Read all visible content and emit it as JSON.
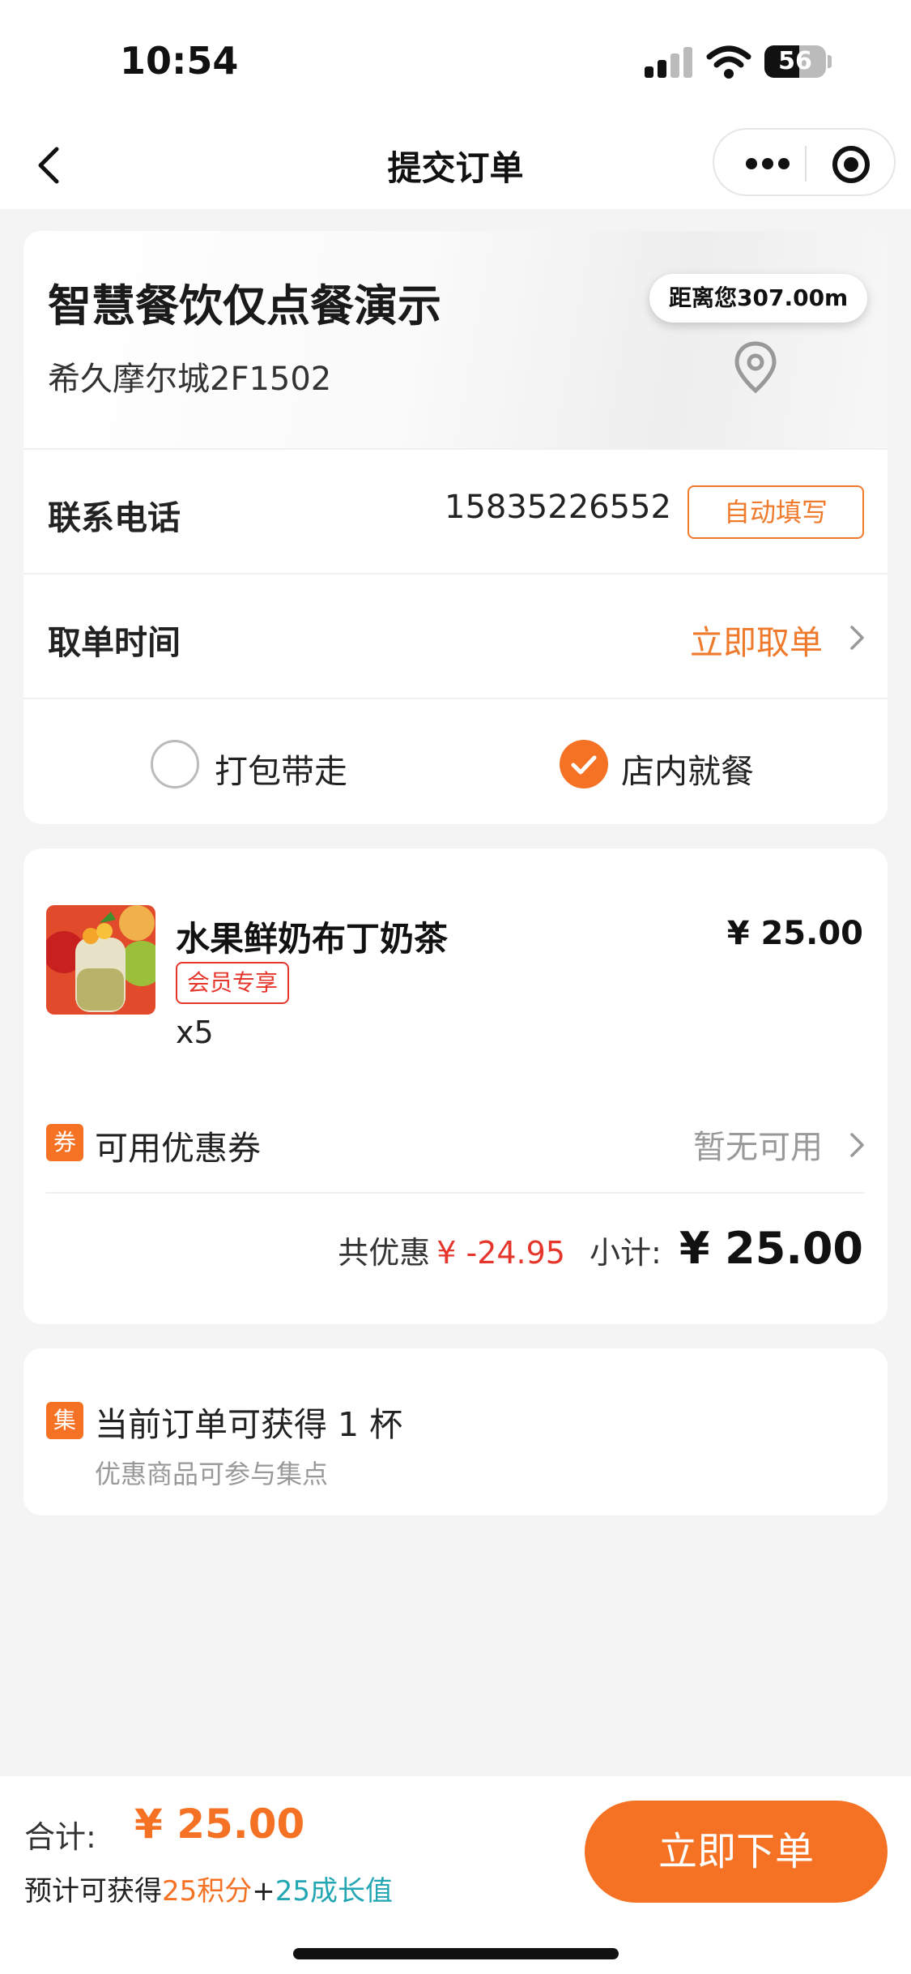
{
  "status_bar": {
    "time": "10:54",
    "battery": "56"
  },
  "nav": {
    "title": "提交订单"
  },
  "store": {
    "name": "智慧餐饮仅点餐演示",
    "address": "希久摩尔城2F1502",
    "distance": "距离您307.00m"
  },
  "contact": {
    "label": "联系电话",
    "phone": "15835226552",
    "autofill_label": "自动填写"
  },
  "pickup": {
    "label": "取单时间",
    "value": "立即取单"
  },
  "dining": {
    "options": [
      {
        "label": "打包带走",
        "selected": false
      },
      {
        "label": "店内就餐",
        "selected": true
      }
    ]
  },
  "order": {
    "item": {
      "name": "水果鲜奶布丁奶茶",
      "tag": "会员专享",
      "qty": "x5",
      "price": "¥ 25.00"
    },
    "coupon": {
      "badge": "券",
      "label": "可用优惠券",
      "value": "暂无可用"
    },
    "summary": {
      "discount_label": "共优惠",
      "discount_value": "¥ -24.95",
      "subtotal_label": "小计:",
      "subtotal_value": "¥ 25.00"
    }
  },
  "stamp": {
    "badge": "集",
    "title": "当前订单可获得 1 杯",
    "subtitle": "优惠商品可参与集点"
  },
  "footer": {
    "total_label": "合计:",
    "total_value": "¥ 25.00",
    "earn_prefix": "预计可获得",
    "earn_points": "25积分",
    "earn_plus": "+",
    "earn_growth": "25成长值",
    "submit_label": "立即下单"
  },
  "colors": {
    "accent": "#f57224",
    "discount": "#e6362b",
    "growth": "#22a6b3"
  }
}
